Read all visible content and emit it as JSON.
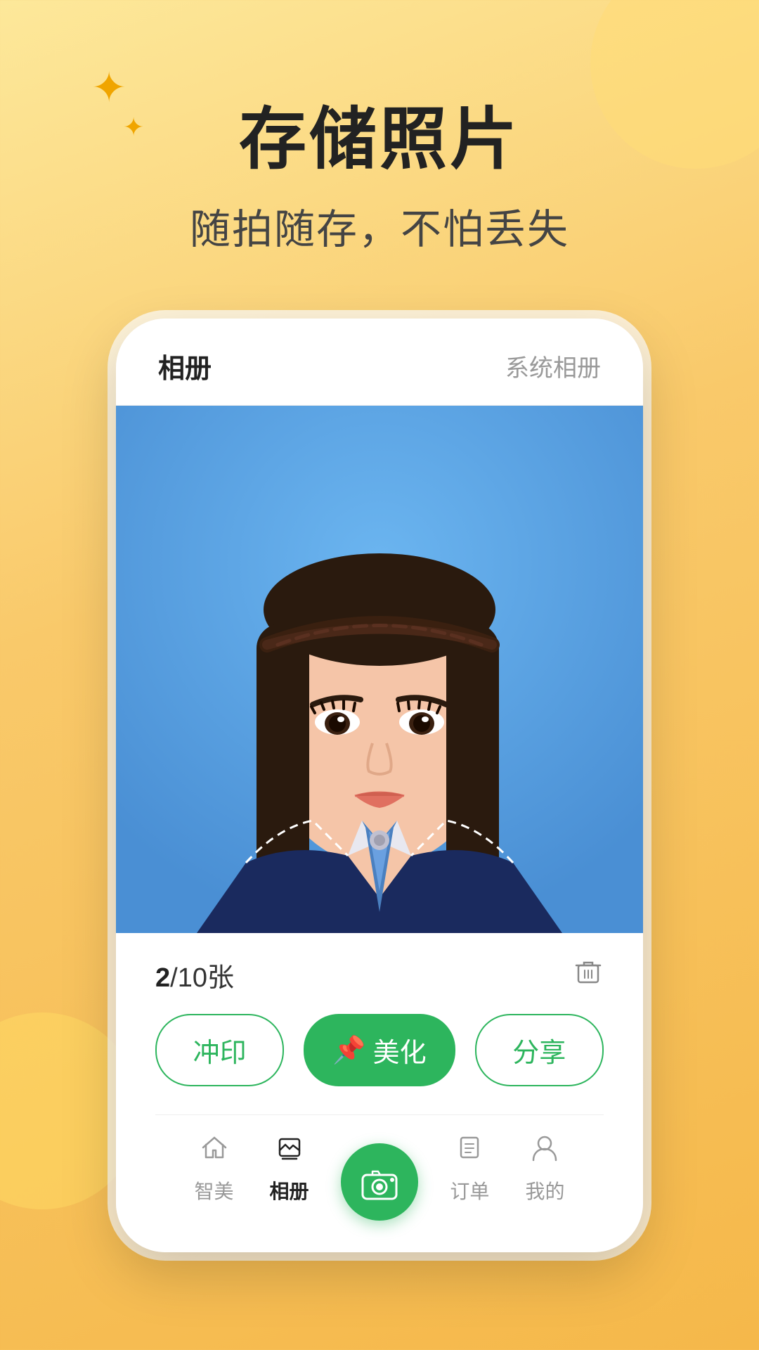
{
  "background": {
    "gradient_start": "#fde89a",
    "gradient_end": "#f5b84a"
  },
  "header": {
    "main_title": "存储照片",
    "sub_title": "随拍随存，不怕丢失",
    "star_large": "✦",
    "star_small": "✦"
  },
  "phone": {
    "topbar": {
      "tab_album": "相册",
      "tab_system": "系统相册"
    },
    "photo": {
      "description": "ID photo of young woman with braided headband in navy blue uniform with blue tie, blue background"
    },
    "count": {
      "current": "2",
      "separator": "/",
      "total": "10",
      "unit": "张"
    },
    "actions": {
      "print_label": "冲印",
      "beautify_label": "美化",
      "share_label": "分享",
      "pin_icon": "📌"
    },
    "delete_icon": "🗑"
  },
  "bottom_nav": {
    "items": [
      {
        "id": "home",
        "label": "智美",
        "icon": "house",
        "active": false
      },
      {
        "id": "album",
        "label": "相册",
        "icon": "album",
        "active": true
      },
      {
        "id": "camera",
        "label": "",
        "icon": "camera",
        "active": false,
        "is_center": true
      },
      {
        "id": "orders",
        "label": "订单",
        "icon": "orders",
        "active": false
      },
      {
        "id": "mine",
        "label": "我的",
        "icon": "mine",
        "active": false
      }
    ]
  }
}
